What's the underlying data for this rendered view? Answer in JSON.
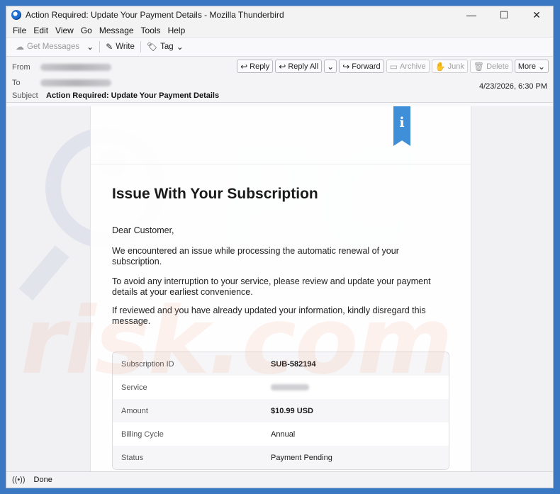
{
  "window": {
    "title": "Action Required: Update Your Payment Details - Mozilla Thunderbird",
    "controls": {
      "minimize": "—",
      "maximize": "☐",
      "close": "✕"
    }
  },
  "menu": [
    "File",
    "Edit",
    "View",
    "Go",
    "Message",
    "Tools",
    "Help"
  ],
  "toolbar": {
    "get_messages": "Get Messages",
    "write": "Write",
    "tag": "Tag"
  },
  "header": {
    "from_label": "From",
    "to_label": "To",
    "subject_label": "Subject",
    "subject": "Action Required: Update Your Payment Details",
    "date": "4/23/2026, 6:30 PM",
    "actions": {
      "reply": "Reply",
      "reply_all": "Reply All",
      "forward": "Forward",
      "archive": "Archive",
      "junk": "Junk",
      "delete": "Delete",
      "more": "More"
    }
  },
  "email": {
    "title": "Issue With Your Subscription",
    "greeting": "Dear Customer,",
    "p1": "We encountered an issue while processing the automatic renewal of your subscription.",
    "p2": "To avoid any interruption to your service, please review and update your payment details at your earliest convenience.",
    "p3": "If reviewed and you have already updated your information, kindly disregard this message.",
    "table": [
      {
        "key": "Subscription ID",
        "value": "SUB-582194"
      },
      {
        "key": "Service",
        "value": ""
      },
      {
        "key": "Amount",
        "value": "$10.99 USD"
      },
      {
        "key": "Billing Cycle",
        "value": "Annual"
      },
      {
        "key": "Status",
        "value": "Payment Pending"
      }
    ]
  },
  "watermark": {
    "top": "PC",
    "bottom": "risk.com"
  },
  "status": {
    "text": "Done"
  }
}
